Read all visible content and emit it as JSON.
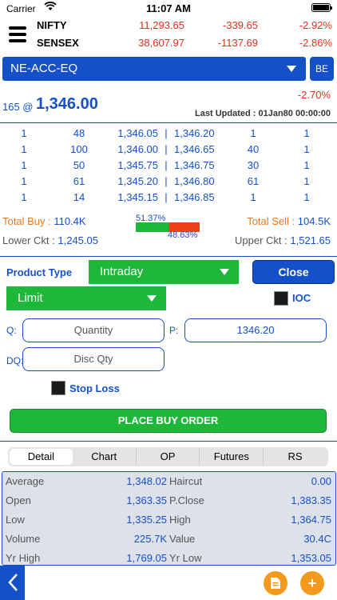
{
  "status_bar": {
    "carrier": "Carrier",
    "time": "11:07 AM"
  },
  "indices": [
    {
      "name": "NIFTY",
      "value": "11,293.65",
      "change": "-339.65",
      "percent": "-2.92%"
    },
    {
      "name": "SENSEX",
      "value": "38,607.97",
      "change": "-1137.69",
      "percent": "-2.86%"
    }
  ],
  "symbol": {
    "name": "NE-ACC-EQ",
    "exchange_button": "BE"
  },
  "quote": {
    "qty": "165 @",
    "ltp": "1,346.00",
    "percent_change": "-2.70%",
    "last_updated": "Last Updated : 01Jan80 00:00:00"
  },
  "depth": {
    "rows": [
      [
        "1",
        "48",
        "1,346.05",
        "|",
        "1,346.20",
        "1",
        "1"
      ],
      [
        "1",
        "100",
        "1,346.00",
        "|",
        "1,346.65",
        "40",
        "1"
      ],
      [
        "1",
        "50",
        "1,345.75",
        "|",
        "1,346.75",
        "30",
        "1"
      ],
      [
        "1",
        "61",
        "1,345.20",
        "|",
        "1,346.80",
        "61",
        "1"
      ],
      [
        "1",
        "14",
        "1,345.15",
        "|",
        "1,346.85",
        "1",
        "1"
      ]
    ]
  },
  "totals": {
    "total_buy_label": "Total Buy :",
    "total_buy_value": "110.4K",
    "total_sell_label": "Total Sell :",
    "total_sell_value": "104.5K",
    "buy_percent": "51.37%",
    "sell_percent": "48.63%",
    "buy_fraction": 0.5137,
    "lower_ckt_label": "Lower Ckt :",
    "lower_ckt_value": "1,245.05",
    "upper_ckt_label": "Upper Ckt :",
    "upper_ckt_value": "1,521.65"
  },
  "order_form": {
    "product_type_label": "Product Type",
    "product_type_value": "Intraday",
    "close_button": "Close",
    "order_type_value": "Limit",
    "ioc_label": "IOC",
    "q_label": "Q:",
    "quantity_placeholder": "Quantity",
    "p_label": "P:",
    "price_value": "1346.20",
    "dq_label": "DQ:",
    "disc_qty_placeholder": "Disc Qty",
    "stop_loss_label": "Stop Loss",
    "place_button": "PLACE BUY ORDER"
  },
  "tabs": [
    "Detail",
    "Chart",
    "OP",
    "Futures",
    "RS"
  ],
  "details": [
    [
      "Average",
      "1,348.02",
      "Haircut",
      "0.00"
    ],
    [
      "Open",
      "1,363.35",
      "P.Close",
      "1,383.35"
    ],
    [
      "Low",
      "1,335.25",
      "High",
      "1,364.75"
    ],
    [
      "Volume",
      "225.7K",
      "Value",
      "30.4C"
    ],
    [
      "Yr High",
      "1,769.05",
      "Yr Low",
      "1,353.05"
    ]
  ],
  "colors": {
    "accent_blue": "#1550c8",
    "buy_green": "#1db83a",
    "sell_red": "#f0401a",
    "negative_red": "#e0301e",
    "orange": "#f39a1d"
  },
  "icons": {
    "menu": "hamburger-icon",
    "wifi": "wifi-icon",
    "back": "chevron-left-icon",
    "doc": "document-icon",
    "add": "plus-icon"
  }
}
